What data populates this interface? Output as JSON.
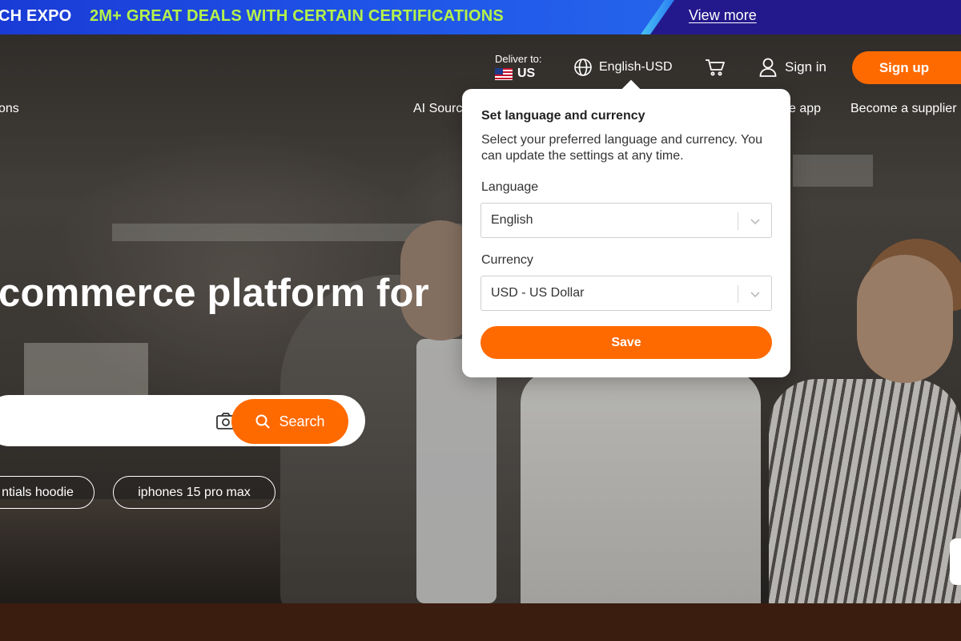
{
  "promo": {
    "brand_text": "CH  EXPO",
    "headline": "2M+ GREAT DEALS WITH CERTAIN CERTIFICATIONS",
    "link": "View more"
  },
  "header": {
    "deliver_label": "Deliver to:",
    "deliver_country": "US",
    "language_currency": "English-USD",
    "sign_in": "Sign in",
    "sign_up": "Sign up"
  },
  "nav": {
    "left_item": "ons",
    "ai_sourcing": "AI Sourc",
    "app": "e app",
    "become_supplier": "Become a supplier"
  },
  "hero": {
    "headline": "commerce platform for",
    "search_placeholder": "",
    "search_button": "Search",
    "chips": [
      "ntials hoodie",
      "iphones 15 pro max"
    ]
  },
  "popover": {
    "title": "Set language and currency",
    "description": "Select your preferred language and currency. You can update the settings at any time.",
    "language_label": "Language",
    "language_value": "English",
    "currency_label": "Currency",
    "currency_value": "USD - US Dollar",
    "save": "Save"
  },
  "colors": {
    "accent": "#ff6a00",
    "promo_text": "#b6f24a",
    "promo_bg": "#1f54e8"
  },
  "icons": {
    "language": "globe-icon",
    "cart": "cart-icon",
    "user": "user-icon",
    "camera": "camera-icon",
    "search": "search-icon",
    "dropdown": "chevron-down-icon"
  }
}
